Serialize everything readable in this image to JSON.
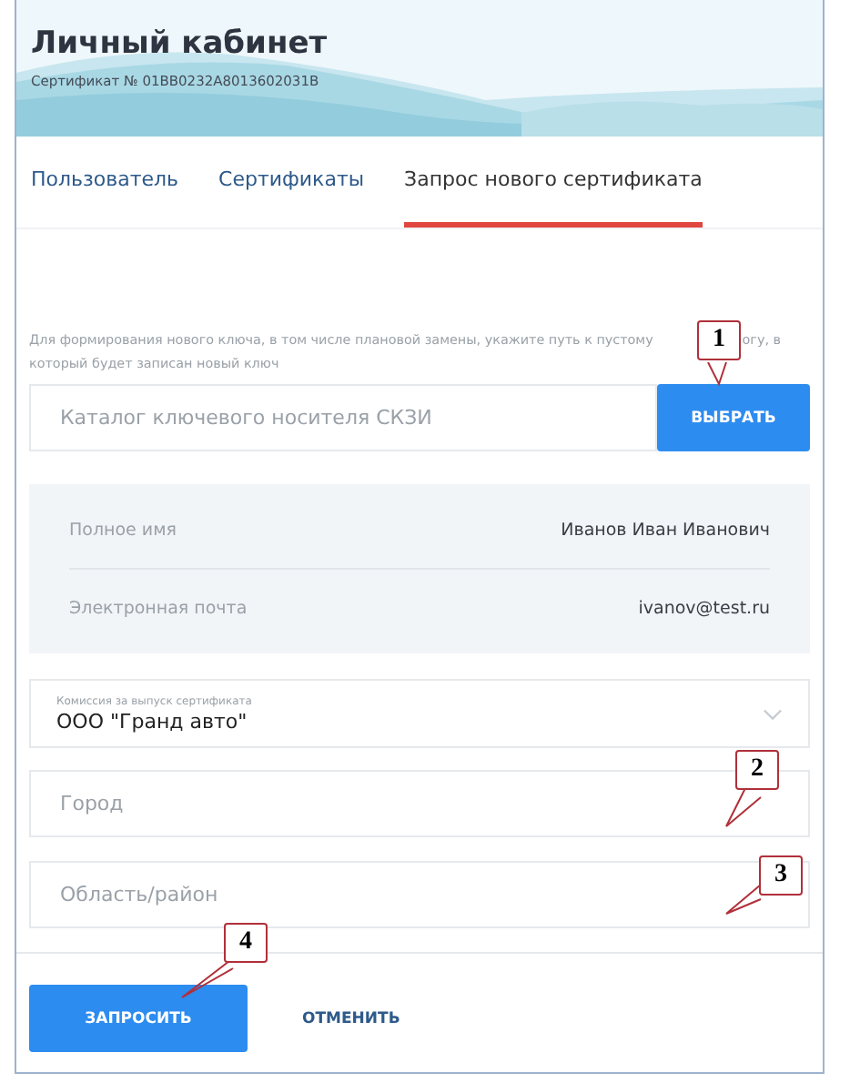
{
  "header": {
    "title": "Личный кабинет",
    "subtitle": "Сертификат № 01BB0232A8013602031B"
  },
  "tabs": [
    {
      "label": "Пользователь",
      "selected": false
    },
    {
      "label": "Сертификаты",
      "selected": false
    },
    {
      "label": "Запрос нового сертификата",
      "selected": true
    }
  ],
  "hint": {
    "before": "Для формирования нового ключа, в том числе плановой замены, укажите путь к пустому",
    "after": "огу, в",
    "second_line": "который будет записан новый ключ"
  },
  "key_field": {
    "placeholder": "Каталог ключевого носителя СКЗИ"
  },
  "choose_button": "ВЫБРАТЬ",
  "info": [
    {
      "label": "Полное имя",
      "value": "Иванов Иван Иванович"
    },
    {
      "label": "Электронная почта",
      "value": "ivanov@test.ru"
    }
  ],
  "fee_select": {
    "label": "Комиссия за выпуск сертификата",
    "value": "ООО \"Гранд авто\""
  },
  "fields": [
    {
      "placeholder": "Город"
    },
    {
      "placeholder": "Область/район"
    }
  ],
  "buttons": {
    "submit": "ЗАПРОСИТЬ",
    "cancel": "ОТМЕНИТЬ"
  },
  "callouts": [
    {
      "number": "1"
    },
    {
      "number": "2"
    },
    {
      "number": "3"
    },
    {
      "number": "4"
    }
  ]
}
